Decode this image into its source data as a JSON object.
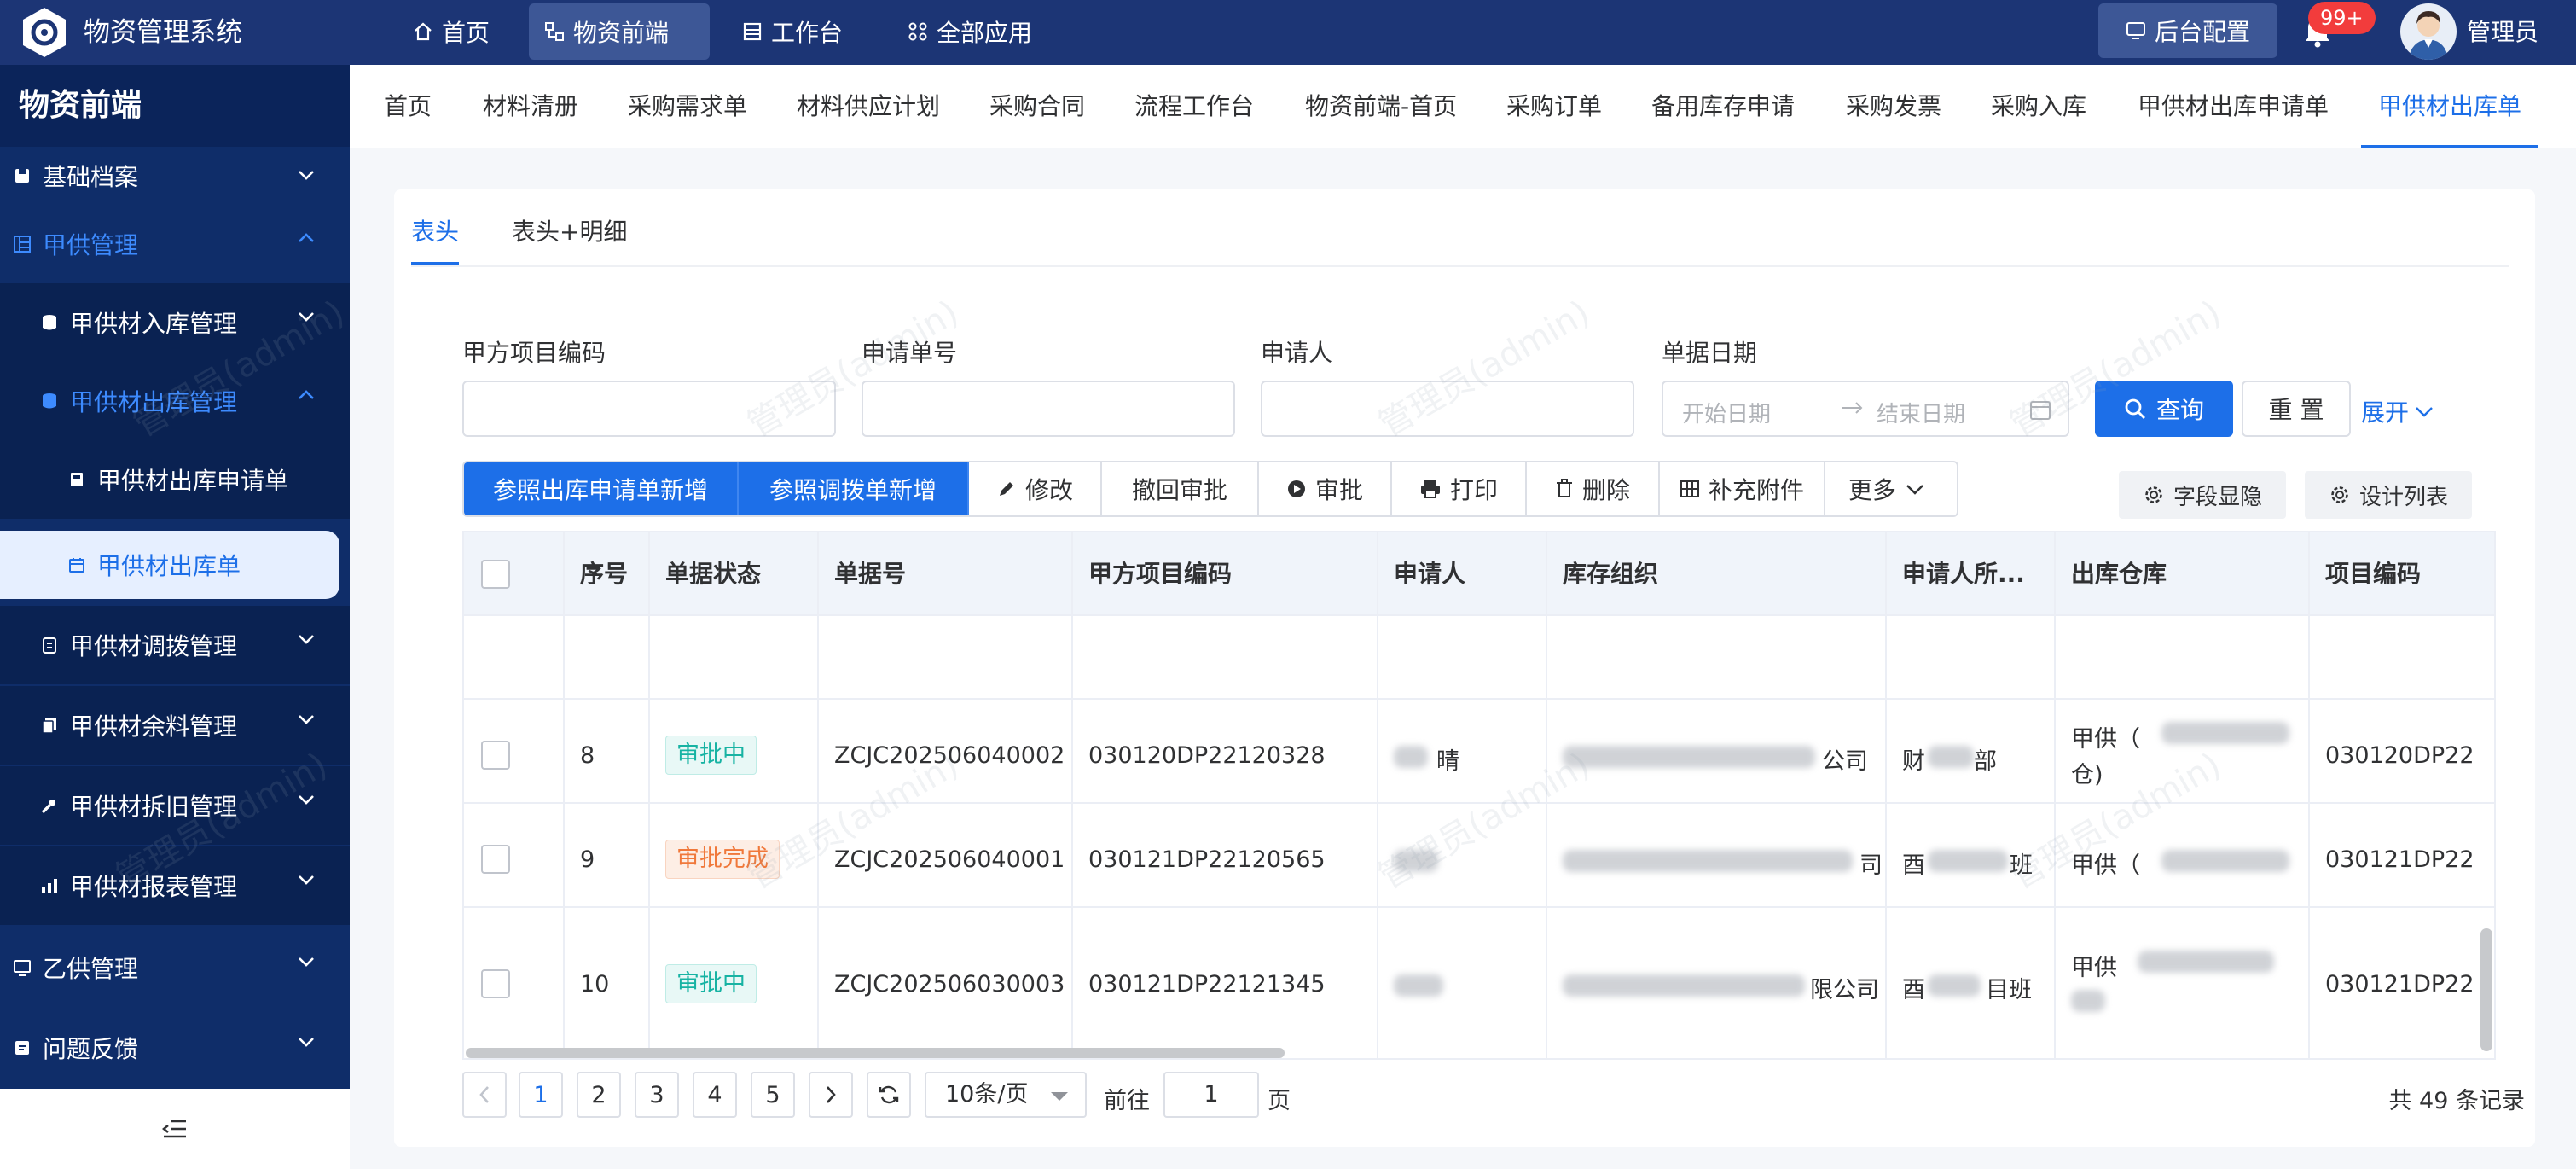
{
  "app": {
    "title": "物资管理系统"
  },
  "topnav": [
    {
      "label": "首页",
      "icon": "home-icon"
    },
    {
      "label": "物资前端",
      "icon": "grid-icon"
    },
    {
      "label": "工作台",
      "icon": "desk-icon"
    },
    {
      "label": "全部应用",
      "icon": "apps-icon"
    }
  ],
  "header": {
    "backend_label": "后台配置",
    "badge": "99+",
    "user": "管理员"
  },
  "sidebar": {
    "title": "物资前端",
    "items": [
      {
        "label": "基础档案"
      },
      {
        "label": "甲供管理"
      },
      {
        "label": "甲供材入库管理"
      },
      {
        "label": "甲供材出库管理"
      },
      {
        "label": "甲供材出库申请单"
      },
      {
        "label": "甲供材出库单"
      },
      {
        "label": "甲供材调拨管理"
      },
      {
        "label": "甲供材余料管理"
      },
      {
        "label": "甲供材拆旧管理"
      },
      {
        "label": "甲供材报表管理"
      },
      {
        "label": "乙供管理"
      },
      {
        "label": "问题反馈"
      }
    ]
  },
  "page_tabs": [
    "首页",
    "材料清册",
    "采购需求单",
    "材料供应计划",
    "采购合同",
    "流程工作台",
    "物资前端-首页",
    "采购订单",
    "备用库存申请",
    "采购发票",
    "采购入库",
    "甲供材出库申请单",
    "甲供材出库单"
  ],
  "sub_tabs": [
    "表头",
    "表头+明细"
  ],
  "filters": {
    "project_code": "甲方项目编码",
    "apply_no": "申请单号",
    "applicant": "申请人",
    "doc_date": "单据日期",
    "date_start": "开始日期",
    "date_end": "结束日期",
    "query": "查询",
    "reset": "重 置",
    "expand": "展开"
  },
  "toolbar": {
    "add_by_request": "参照出库申请单新增",
    "add_by_transfer": "参照调拨单新增",
    "edit": "修改",
    "withdraw": "撤回审批",
    "approve": "审批",
    "print": "打印",
    "delete": "删除",
    "attach": "补充附件",
    "more": "更多",
    "field_display": "字段显隐",
    "design_list": "设计列表"
  },
  "table": {
    "columns": [
      "序号",
      "单据状态",
      "单据号",
      "甲方项目编码",
      "申请人",
      "库存组织",
      "申请人所...",
      "出库仓库",
      "项目编码"
    ],
    "rows": [
      {
        "no": "8",
        "status": "审批中",
        "doc_no": "ZCJC202506040002",
        "project_code": "030120DP22120328",
        "applicant_tail": "晴",
        "org_tail": "公司",
        "dept_head": "财",
        "dept_tail": "部",
        "wh_line1": "甲供（",
        "wh_line2": "仓)",
        "item_code": "030120DP22"
      },
      {
        "no": "9",
        "status": "审批完成",
        "doc_no": "ZCJC202506040001",
        "project_code": "030121DP22120565",
        "applicant_tail": "",
        "org_tail": "司",
        "dept_head": "酉",
        "dept_tail": "班",
        "wh_line1": "甲供（",
        "wh_line2": "",
        "item_code": "030121DP22"
      },
      {
        "no": "10",
        "status": "审批中",
        "doc_no": "ZCJC202506030003",
        "project_code": "030121DP22121345",
        "applicant_tail": "",
        "org_tail": "限公司",
        "dept_head": "酉",
        "dept_tail": "目班",
        "wh_line1": "甲供",
        "wh_line2": "",
        "item_code": "030121DP22"
      }
    ]
  },
  "pagination": {
    "pages": [
      "1",
      "2",
      "3",
      "4",
      "5"
    ],
    "current": "1",
    "page_size": "10条/页",
    "goto_label": "前往",
    "goto_value": "1",
    "page_unit": "页",
    "total": "共 49 条记录"
  },
  "watermark": "管理员(admin)"
}
